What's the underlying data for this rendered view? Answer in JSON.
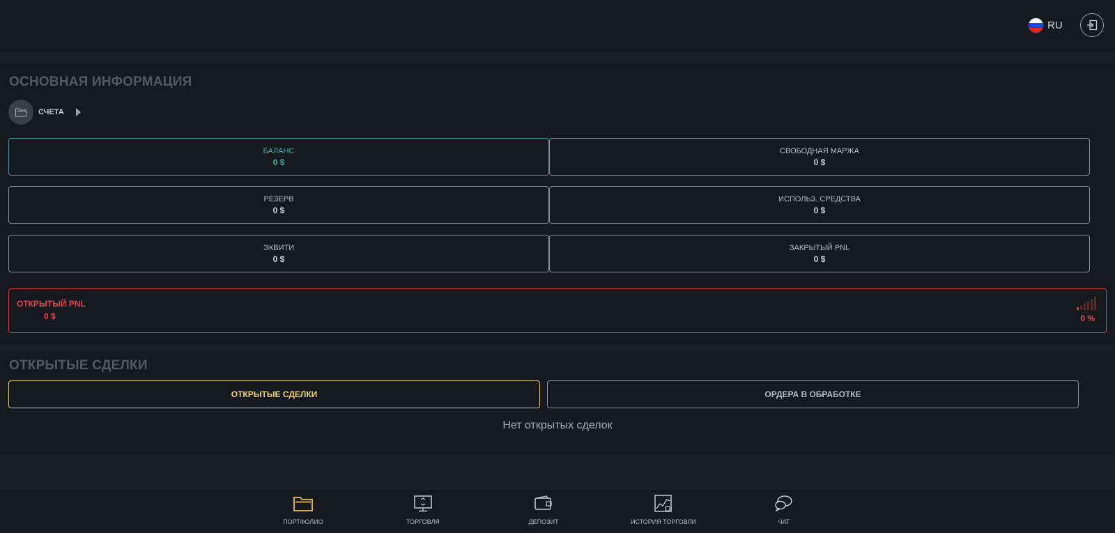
{
  "header": {
    "language": "RU",
    "flag_icon": "russia-flag-icon",
    "logout_icon": "logout-icon"
  },
  "main_info": {
    "title": "ОСНОВНАЯ ИНФОРМАЦИЯ",
    "accounts_label": "СЧЕТА",
    "cards": [
      {
        "label": "БАЛАНС",
        "value": "0 $",
        "active": true
      },
      {
        "label": "СВОБОДНАЯ МАРЖА",
        "value": "0 $"
      },
      {
        "label": "РЕЗЕРВ",
        "value": "0 $"
      },
      {
        "label": "ИСПОЛЬЗ. СРЕДСТВА",
        "value": "0 $"
      },
      {
        "label": "ЭКВИТИ",
        "value": "0 $"
      },
      {
        "label": "ЗАКРЫТЫЙ PNL",
        "value": "0 $"
      }
    ],
    "open_pnl": {
      "label": "ОТКРЫТЫЙ PNL",
      "value": "0 $",
      "percent": "0 %"
    }
  },
  "open_trades": {
    "title": "ОТКРЫТЫЕ СДЕЛКИ",
    "tabs": [
      {
        "label": "ОТКРЫТЫЕ СДЕЛКИ",
        "active": true
      },
      {
        "label": "ОРДЕРА В ОБРАБОТКЕ",
        "active": false
      }
    ],
    "empty_message": "Нет открытых сделок"
  },
  "bottom_nav": [
    {
      "label": "ПОРТФОЛИО",
      "icon": "folder-icon",
      "active": true
    },
    {
      "label": "ТОРГОВЛЯ",
      "icon": "trading-monitor-icon"
    },
    {
      "label": "ДЕПОЗИТ",
      "icon": "wallet-icon"
    },
    {
      "label": "ИСТОРИЯ ТОРГОВЛИ",
      "icon": "trade-history-icon"
    },
    {
      "label": "ЧАТ",
      "icon": "chat-icon"
    }
  ],
  "colors": {
    "background": "#1c1f25",
    "panel": "#16191e",
    "accent_teal": "#41b3a9",
    "accent_red": "#e2464f",
    "accent_gold": "#f0d274"
  }
}
